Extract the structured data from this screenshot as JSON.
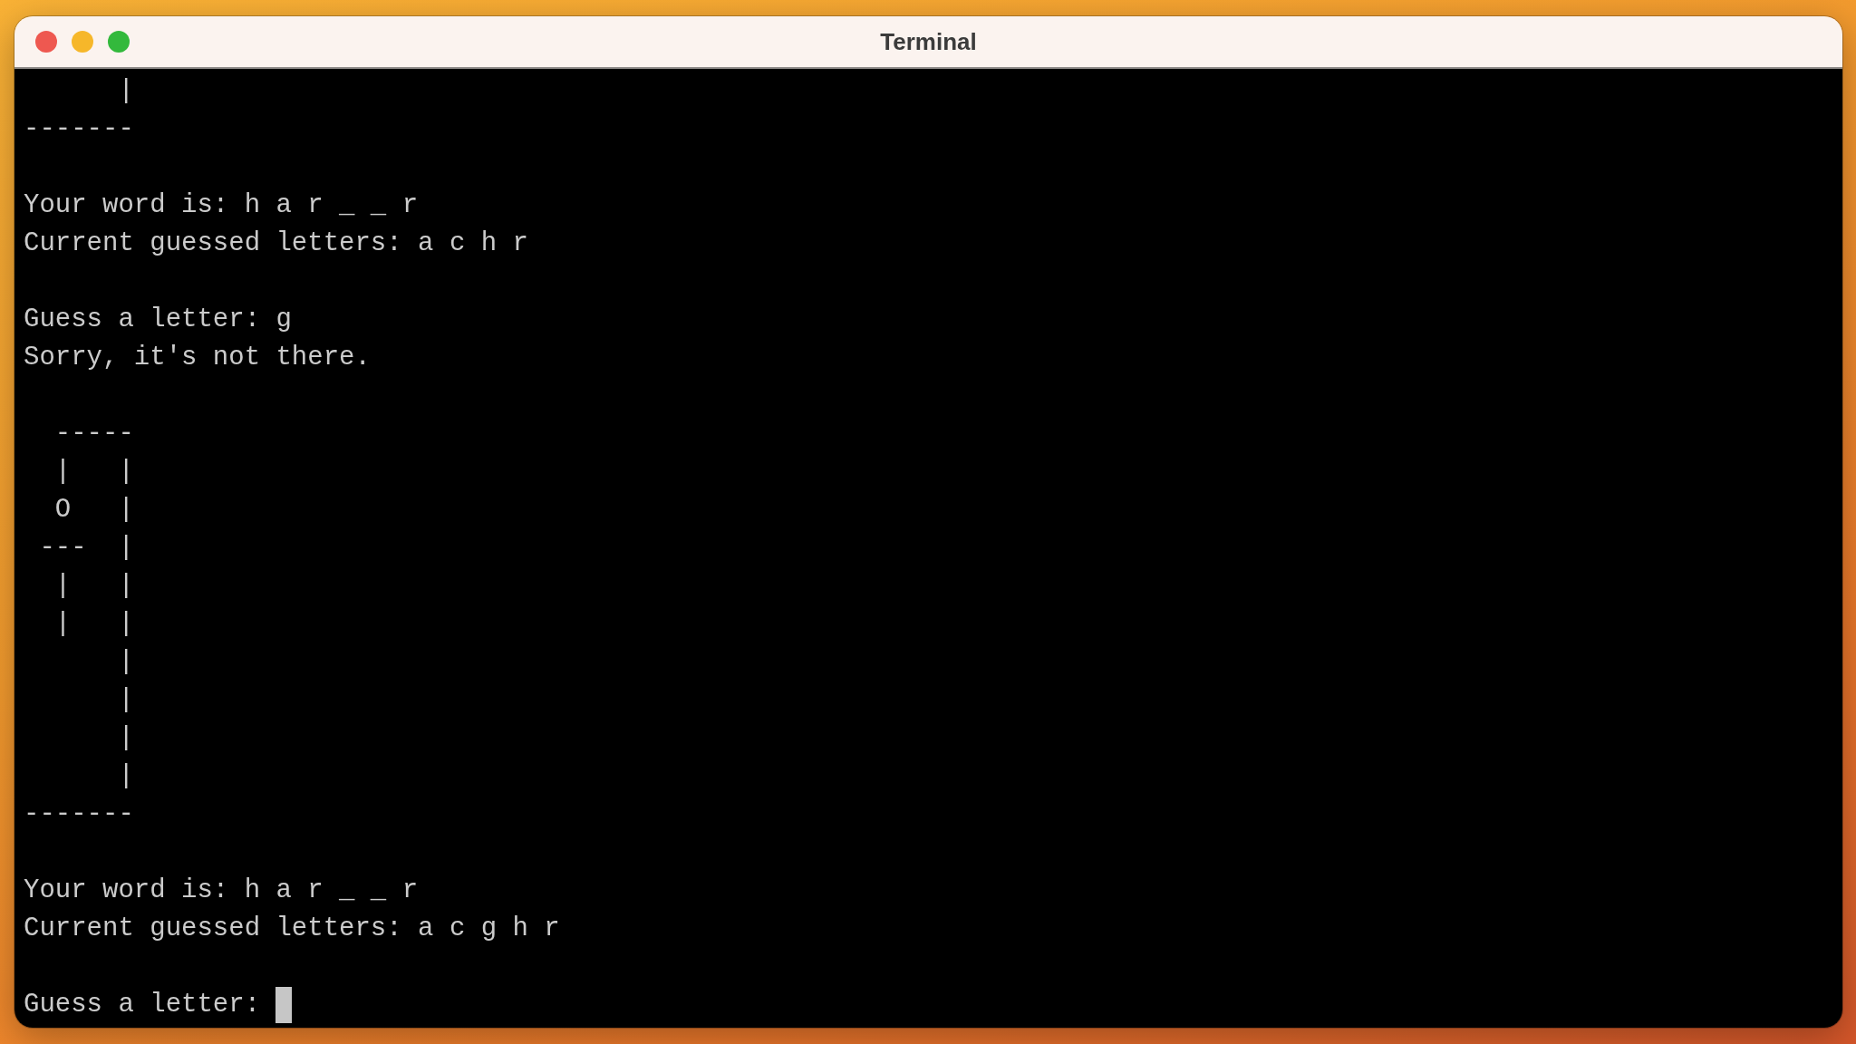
{
  "window": {
    "title": "Terminal"
  },
  "terminal": {
    "lines": [
      {
        "kind": "text",
        "text": "      |"
      },
      {
        "kind": "text",
        "text": "-------"
      },
      {
        "kind": "blank"
      },
      {
        "kind": "text",
        "text": "Your word is: h a r _ _ r"
      },
      {
        "kind": "text",
        "text": "Current guessed letters: a c h r"
      },
      {
        "kind": "blank"
      },
      {
        "kind": "text",
        "text": "Guess a letter: g"
      },
      {
        "kind": "text",
        "text": "Sorry, it's not there."
      },
      {
        "kind": "blank"
      },
      {
        "kind": "text",
        "text": "  -----"
      },
      {
        "kind": "text",
        "text": "  |   |"
      },
      {
        "kind": "text",
        "text": "  O   |"
      },
      {
        "kind": "text",
        "text": " ---  |"
      },
      {
        "kind": "text",
        "text": "  |   |"
      },
      {
        "kind": "text",
        "text": "  |   |"
      },
      {
        "kind": "text",
        "text": "      |"
      },
      {
        "kind": "text",
        "text": "      |"
      },
      {
        "kind": "text",
        "text": "      |"
      },
      {
        "kind": "text",
        "text": "      |"
      },
      {
        "kind": "text",
        "text": "-------"
      },
      {
        "kind": "blank"
      },
      {
        "kind": "text",
        "text": "Your word is: h a r _ _ r"
      },
      {
        "kind": "text",
        "text": "Current guessed letters: a c g h r"
      },
      {
        "kind": "blank"
      },
      {
        "kind": "prompt",
        "text": "Guess a letter:",
        "cursor": true
      }
    ]
  }
}
